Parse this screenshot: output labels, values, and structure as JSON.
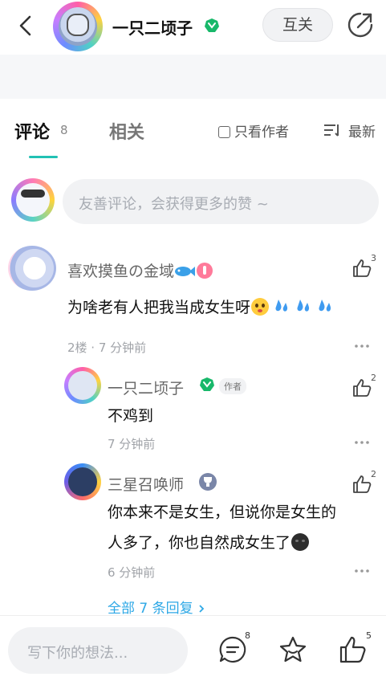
{
  "header": {
    "author_name": "一只二顷子",
    "follow_label": "互关"
  },
  "tabs": {
    "comments_label": "评论",
    "comments_count": "8",
    "related_label": "相关",
    "only_author_label": "只看作者",
    "sort_label": "最新"
  },
  "comment_input": {
    "placeholder": "友善评论，会获得更多的赞 ~"
  },
  "comments": [
    {
      "author": "喜欢摸鱼の金域",
      "text": "为啥老有人把我当成女生呀",
      "likes": "3",
      "meta": "2楼 · 7 分钟前",
      "replies": [
        {
          "author": "一只二顷子",
          "author_tag": "作者",
          "text": "不鸡到",
          "likes": "2",
          "time": "7 分钟前"
        },
        {
          "author": "三星召唤师",
          "text_line1": "你本来不是女生，但说你是女生的",
          "text_line2": "人多了，你也自然成女生了",
          "likes": "2",
          "time": "6 分钟前"
        }
      ],
      "all_replies_label": "全部 7 条回复"
    }
  ],
  "bottom_bar": {
    "input_placeholder": "写下你的想法...",
    "comment_count": "8",
    "like_count": "5"
  },
  "colors": {
    "accent": "#21c1b4",
    "link": "#2ea8e6",
    "verified": "#18b86a"
  }
}
